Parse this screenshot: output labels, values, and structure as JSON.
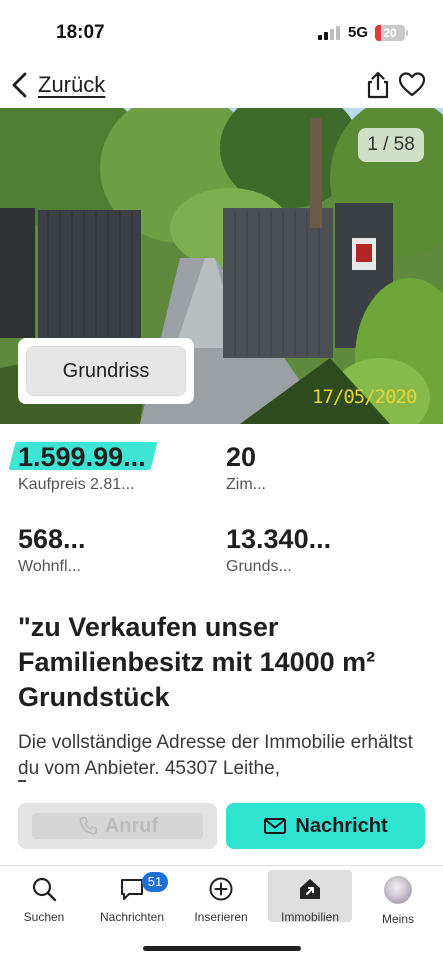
{
  "status_bar": {
    "time": "18:07",
    "network": "5G",
    "battery_level": "20",
    "battery_fraction": 0.2,
    "battery_color": "#e5383b"
  },
  "nav": {
    "back_label": "Zurück",
    "back_icon": "chevron-left-icon",
    "share_icon": "share-icon",
    "favorite_icon": "heart-icon"
  },
  "gallery": {
    "counter": "1 / 58",
    "date_stamp": "17/05/2020",
    "floorplan_label": "Grundriss"
  },
  "facts": [
    {
      "value": "1.599.99...",
      "label": "Kaufpreis 2.81..."
    },
    {
      "value": "20",
      "label": "Zim..."
    },
    {
      "value": "568...",
      "label": "Wohnfl..."
    },
    {
      "value": "13.340...",
      "label": "Grunds..."
    }
  ],
  "listing": {
    "title": "\"zu Verkaufen unser Familienbesitz  mit  14000 m² Grundstück",
    "description": "Die vollständige Adresse der Immobilie erhältst du vom Anbieter. 45307 Leithe,"
  },
  "actions": {
    "call_label": "Anruf",
    "message_label": "Nachricht",
    "call_icon": "phone-icon",
    "message_icon": "envelope-icon"
  },
  "tabs": [
    {
      "label": "Suchen",
      "icon": "search-icon"
    },
    {
      "label": "Nachrichten",
      "icon": "chat-bubble-icon",
      "badge": "51"
    },
    {
      "label": "Inserieren",
      "icon": "plus-circle-icon"
    },
    {
      "label": "Immobilien",
      "icon": "house-icon",
      "active": true
    },
    {
      "label": "Meins",
      "icon": "avatar"
    }
  ],
  "colors": {
    "accent": "#2fe3d1",
    "price_highlight": "#3fe5d4",
    "badge": "#1e6fd9"
  }
}
